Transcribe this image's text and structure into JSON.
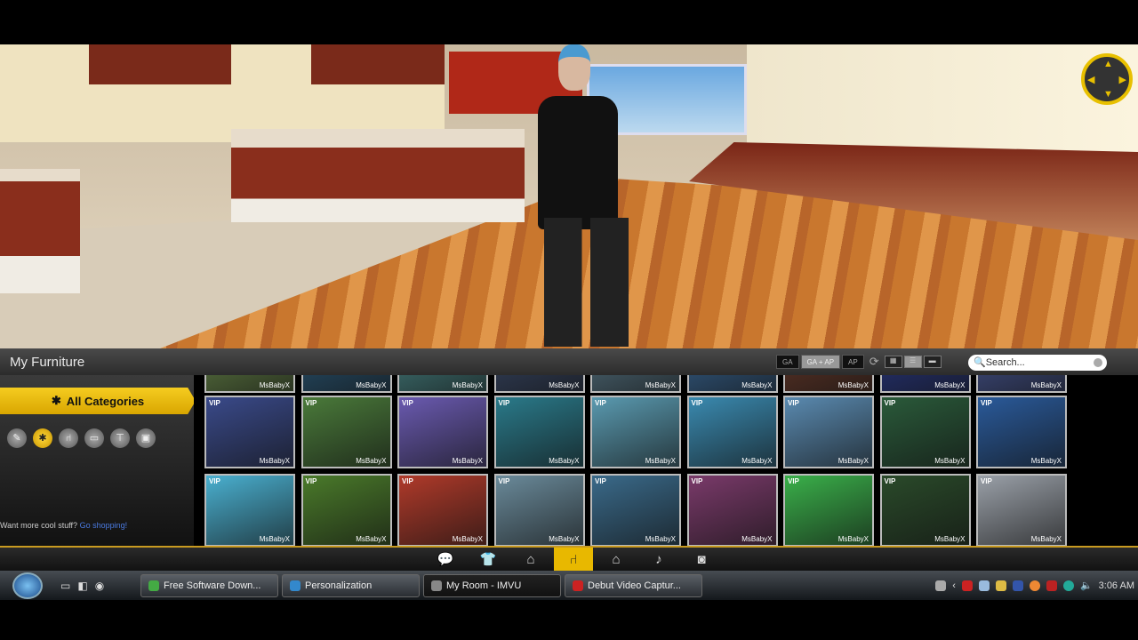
{
  "panel": {
    "title": "My Furniture",
    "ratings": [
      "GA",
      "GA + AP",
      "AP"
    ],
    "active_rating": 1,
    "search_placeholder": "Search..."
  },
  "sidebar": {
    "all_categories": "All Categories",
    "category_icons": [
      "tag-icon",
      "star-icon",
      "chair-icon",
      "bed-icon",
      "table-icon",
      "cabinet-icon"
    ],
    "promo_text": "Want more cool stuff?",
    "promo_link": "Go shopping!"
  },
  "thumb_label": "MsBabyX",
  "vip": "VIP",
  "thumbs_top": [
    "#6a8a4a",
    "#2a5a7a",
    "#4a8a8a",
    "#3a4a6a",
    "#5a7a8a",
    "#3a6a9a",
    "#6a3a2a",
    "#2a3a8a",
    "#4a5a9a"
  ],
  "thumbs_row1": [
    "#3a4a8a",
    "#4a7a3a",
    "#6a5ab0",
    "#2a7a8a",
    "#5a9ab0",
    "#3a8ab0",
    "#5a8ab0",
    "#2a5a3a",
    "#2a5a9a"
  ],
  "thumbs_row2": [
    "#4ab0d0",
    "#4a7a2a",
    "#b03a2a",
    "#6a8a9a",
    "#3a6a8a",
    "#7a3a6a",
    "#3ab04a",
    "#2a4a2a",
    "#9aa0a8"
  ],
  "tabs": [
    {
      "icon": "chat-icon",
      "g": "💬"
    },
    {
      "icon": "shirt-icon",
      "g": "👕"
    },
    {
      "icon": "hanger-icon",
      "g": "⌂"
    },
    {
      "icon": "chair-icon",
      "g": "⑁"
    },
    {
      "icon": "home-icon",
      "g": "⌂"
    },
    {
      "icon": "music-icon",
      "g": "♪"
    },
    {
      "icon": "camera-icon",
      "g": "◙"
    }
  ],
  "active_tab": 3,
  "taskbar": {
    "tasks": [
      "Free Software Down...",
      "Personalization",
      "My Room - IMVU",
      "Debut Video Captur..."
    ],
    "active_task": 2,
    "clock": "3:06 AM"
  }
}
